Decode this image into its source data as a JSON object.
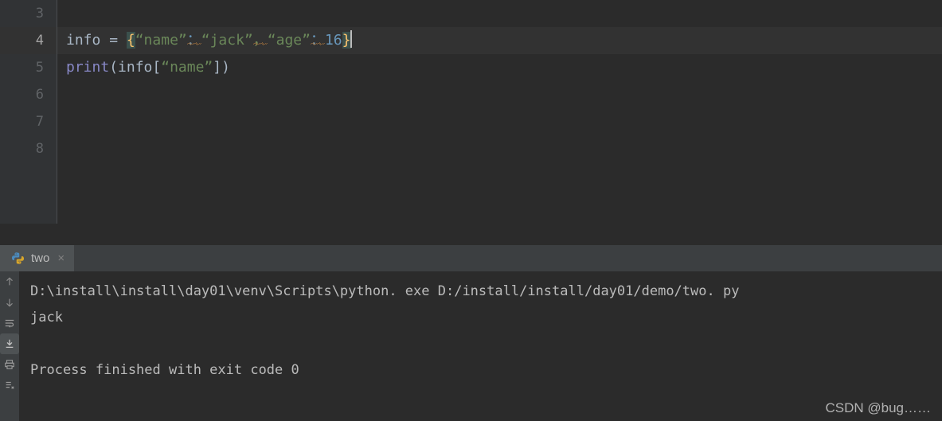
{
  "editor": {
    "gutter_lines": [
      "3",
      "4",
      "5",
      "6",
      "7",
      "8"
    ],
    "current_line_number": "4",
    "lines": [
      {
        "n": "3",
        "text": ""
      },
      {
        "n": "4",
        "text": "info = {“name”：“jack”，“age”：16}"
      },
      {
        "n": "5",
        "text": "print(info[“name”])"
      },
      {
        "n": "6",
        "text": ""
      },
      {
        "n": "7",
        "text": ""
      },
      {
        "n": "8",
        "text": ""
      }
    ],
    "line4": {
      "ident": "info",
      "equals": " = ",
      "open_brace": "{",
      "str_name": "“name”",
      "colon1": "：",
      "str_jack": "“jack”",
      "comma": "，",
      "str_age": "“age”",
      "colon2": "：",
      "number": "16",
      "close_brace": "}"
    },
    "line5": {
      "builtin": "print",
      "open_paren": "(",
      "ident": "info",
      "open_bracket": "[",
      "str_name": "“name”",
      "close_bracket": "]",
      "close_paren": ")"
    },
    "colors": {
      "background": "#2b2b2b",
      "gutter_background": "#313335",
      "current_line_background": "#323232",
      "line_number": "#606366",
      "line_number_current": "#a4a3a3",
      "default_text": "#a9b7c6",
      "string": "#6a8759",
      "number": "#6897bb",
      "builtin": "#8888c6",
      "brace_match_background": "#3b514d",
      "brace_match_text": "#ffc66d",
      "error_squiggle": "#bc8040",
      "caret": "#bbbbbb"
    }
  },
  "run_window": {
    "tab": {
      "icon": "python-icon",
      "label": "two",
      "close": "×"
    },
    "toolbar_buttons": [
      {
        "name": "up-arrow-icon",
        "selected": false
      },
      {
        "name": "down-arrow-icon",
        "selected": false
      },
      {
        "name": "soft-wrap-icon",
        "selected": false
      },
      {
        "name": "scroll-to-end-icon",
        "selected": true
      },
      {
        "name": "print-icon",
        "selected": false
      },
      {
        "name": "clear-all-icon",
        "selected": false
      }
    ],
    "console_lines": [
      "D:\\install\\install\\day01\\venv\\Scripts\\python. exe D:/install/install/day01/demo/two. py",
      "jack",
      "",
      "Process finished with exit code 0"
    ],
    "colors": {
      "tabbar_background": "#3c3f41",
      "tab_selected_background": "#4e5254",
      "console_background": "#2b2b2b",
      "console_text": "#bbbbbb"
    }
  },
  "watermark": {
    "text": "CSDN @bug……"
  }
}
